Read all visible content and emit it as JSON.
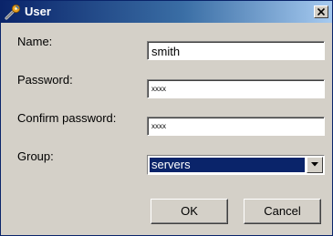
{
  "window": {
    "title": "User",
    "icon": "wrench-icon",
    "close_icon": "close-icon"
  },
  "form": {
    "name_label": "Name:",
    "name_value": "smith",
    "password_label": "Password:",
    "password_value": "xxxx",
    "confirm_label": "Confirm password:",
    "confirm_value": "xxxx",
    "group_label": "Group:",
    "group_value": "servers"
  },
  "buttons": {
    "ok_label": "OK",
    "cancel_label": "Cancel"
  },
  "colors": {
    "titlebar_start": "#0a246a",
    "titlebar_end": "#a6caf0",
    "dialog_bg": "#d4d0c8",
    "selection": "#0a246a"
  }
}
